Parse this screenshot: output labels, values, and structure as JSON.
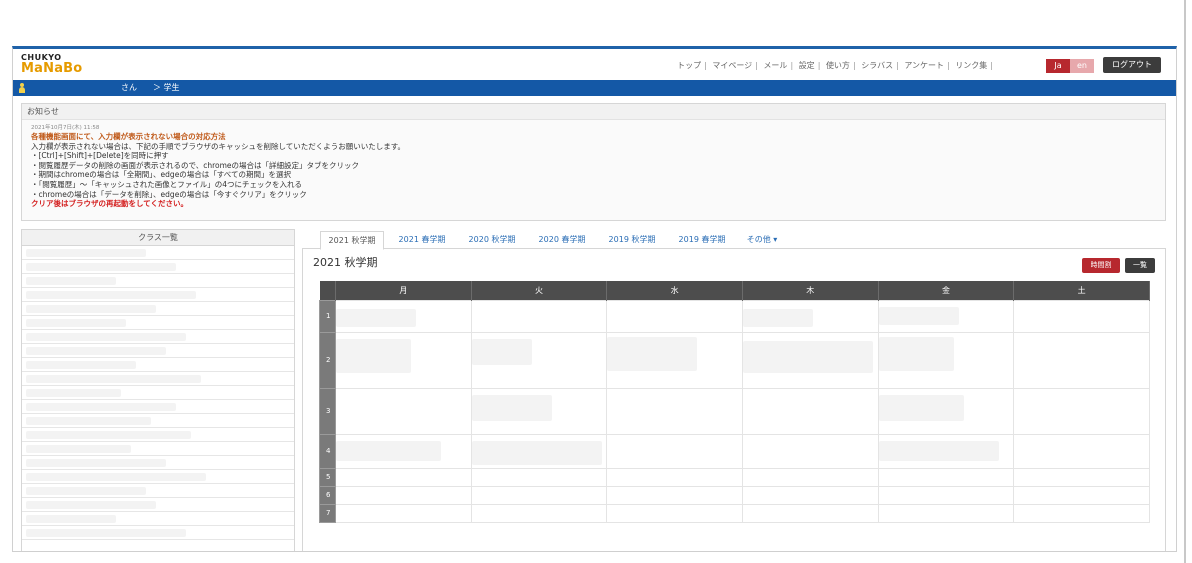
{
  "header": {
    "logo_line1": "CHUKYO",
    "logo_line2": "MaNaBo",
    "nav": [
      "トップ",
      "マイページ",
      "メール",
      "設定",
      "使い方",
      "シラバス",
      "アンケート",
      "リンク集"
    ],
    "lang_ja": "Ja",
    "lang_en": "en",
    "logout_label": "ログアウト"
  },
  "userbar": {
    "name": "さん",
    "role": "＞ 学生"
  },
  "notice": {
    "title": "お知らせ",
    "date": "2021年10月7日(木) 11:58",
    "subject": "各種機能画面にて、入力欄が表示されない場合の対応方法",
    "lines": [
      "入力欄が表示されない場合は、下記の手順でブラウザのキャッシュを削除していただくようお願いいたします。",
      "・[Ctrl]+[Shift]+[Delete]を同時に押す",
      "・閲覧履歴データの削除の画面が表示されるので、chromeの場合は「詳細設定」タブをクリック",
      "・期間はchromeの場合は「全期間」、edgeの場合は「すべての期間」を選択",
      "・「閲覧履歴」～「キャッシュされた画像とファイル」の4つにチェックを入れる",
      "・chromeの場合は「データを削除」、edgeの場合は「今すぐクリア」をクリック"
    ],
    "warning": "クリア後はブラウザの再起動をしてください。"
  },
  "classlist": {
    "title": "クラス一覧"
  },
  "tabs": [
    "2021 秋学期",
    "2021 春学期",
    "2020 秋学期",
    "2020 春学期",
    "2019 秋学期",
    "2019 春学期",
    "その他 ▾"
  ],
  "panel": {
    "term_title": "2021 秋学期",
    "btn_timetable": "時間割",
    "btn_list": "一覧"
  },
  "timetable": {
    "days": [
      "月",
      "火",
      "水",
      "木",
      "金",
      "土"
    ],
    "periods": [
      "1",
      "2",
      "3",
      "4",
      "5",
      "6",
      "7"
    ]
  },
  "colors": {
    "brand_blue": "#1458a6",
    "accent_red": "#b7282e",
    "logo_orange": "#e69b00"
  }
}
